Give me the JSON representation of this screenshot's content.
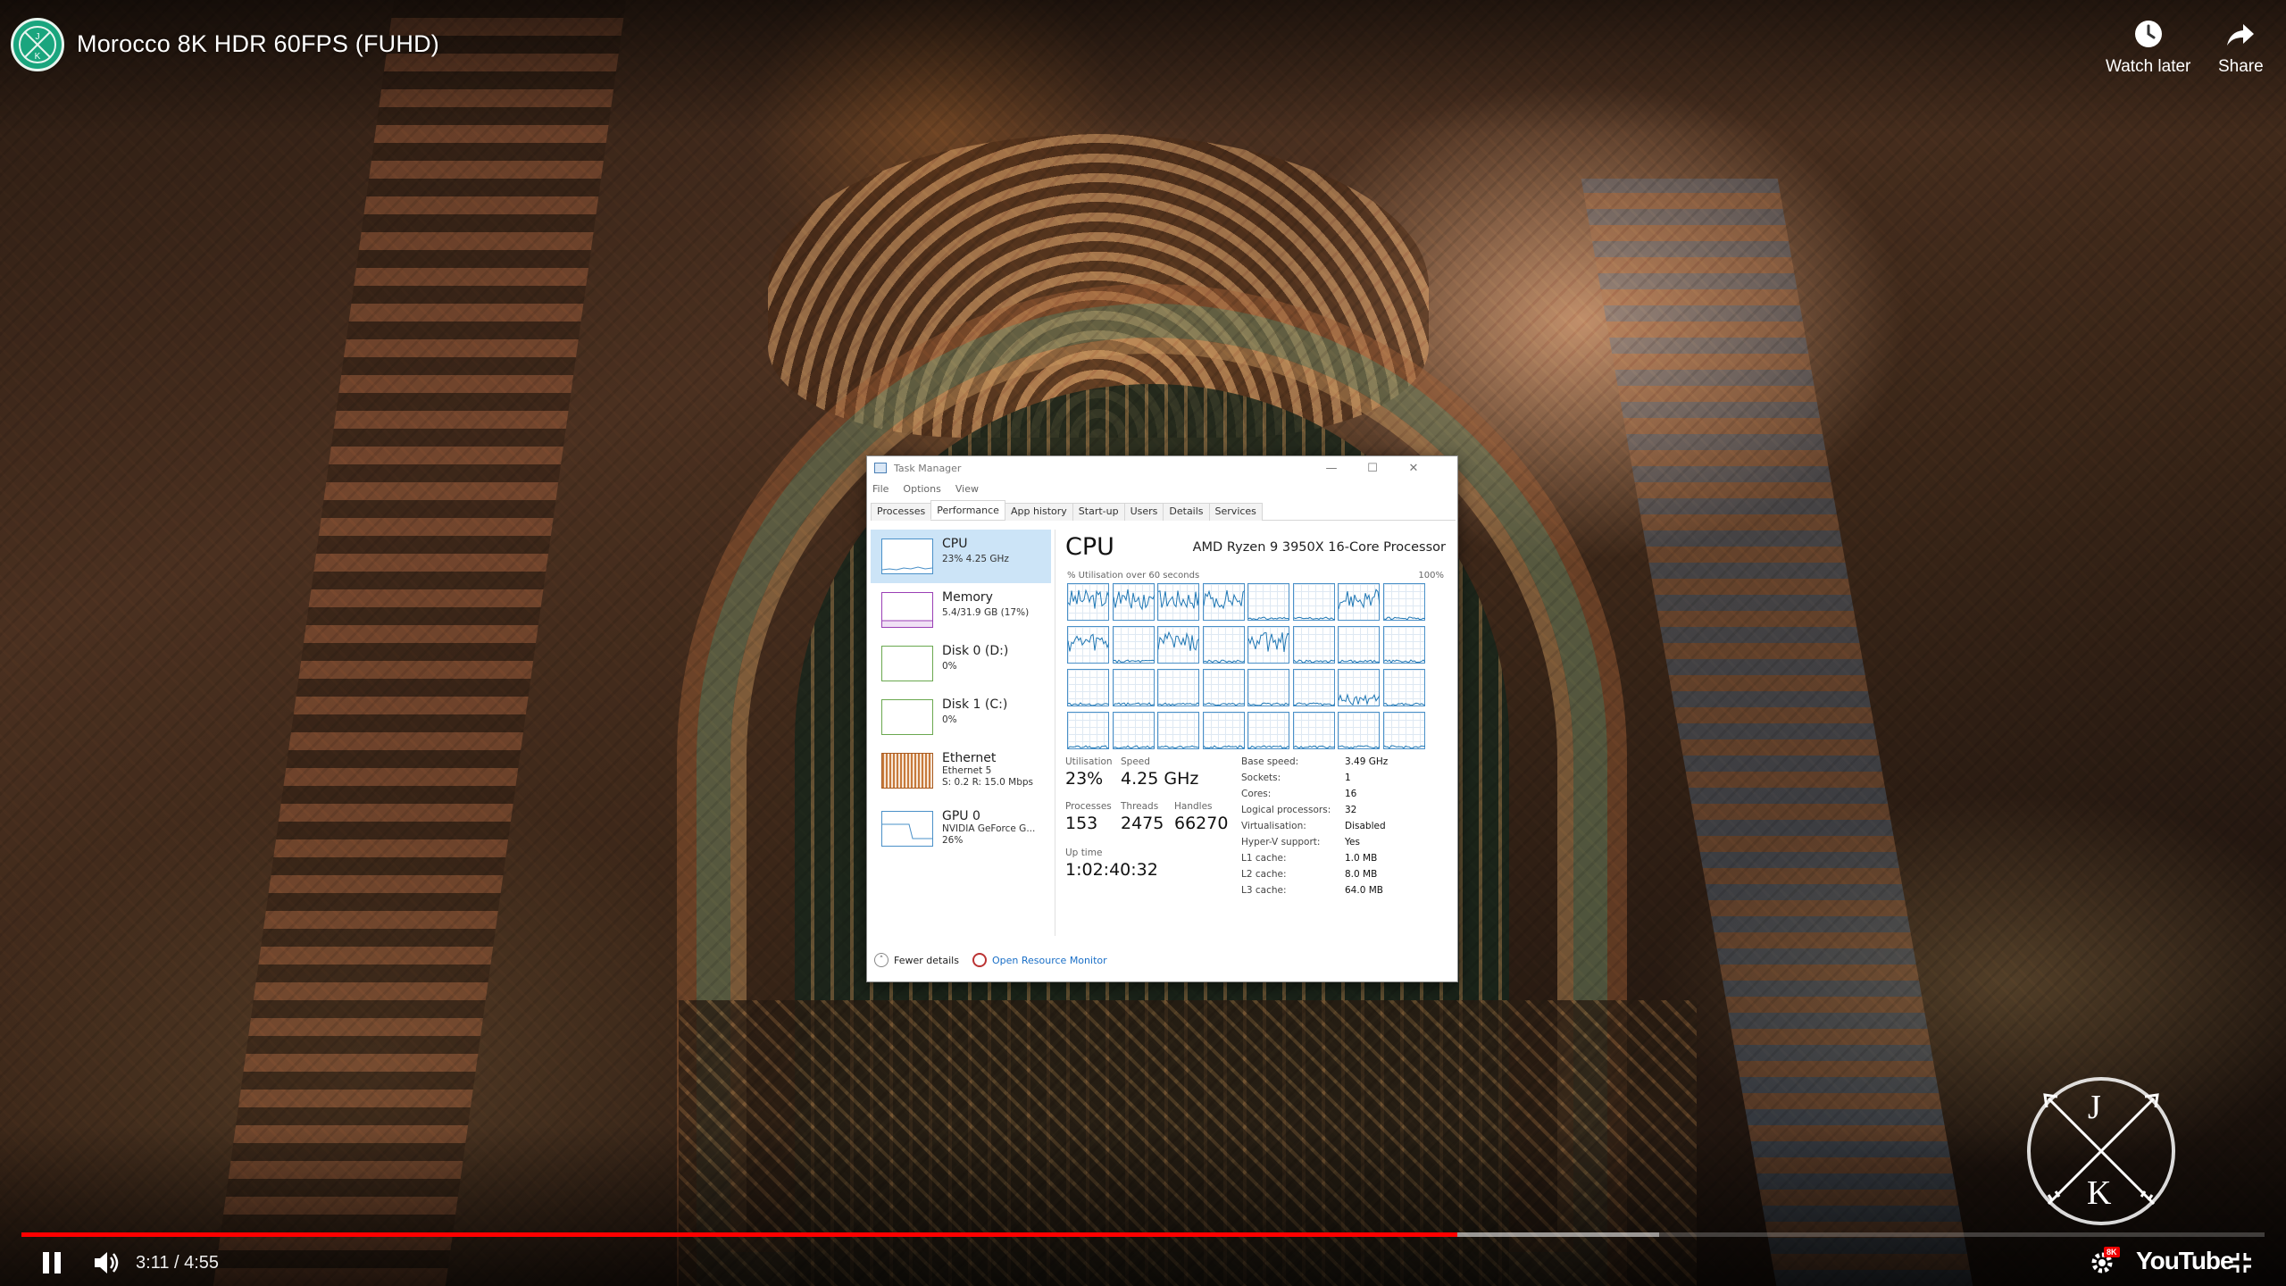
{
  "player": {
    "title": "Morocco 8K HDR 60FPS (FUHD)",
    "watch_later": "Watch later",
    "share": "Share",
    "time": "3:11 / 4:55",
    "progress_played": 0.64,
    "progress_buffered": 0.73,
    "brand": "YouTube",
    "quality_badge": "8K",
    "channel_logo_text": "JK",
    "watermark_top": "J",
    "watermark_bottom": "K",
    "accent_color": "#ff0000"
  },
  "task_manager": {
    "window_title": "Task Manager",
    "menu": [
      "File",
      "Options",
      "View"
    ],
    "tabs": [
      "Processes",
      "Performance",
      "App history",
      "Start-up",
      "Users",
      "Details",
      "Services"
    ],
    "active_tab": "Performance",
    "sidebar": [
      {
        "name": "CPU",
        "sub1": "23% 4.25 GHz",
        "sub2": "",
        "sub3": ""
      },
      {
        "name": "Memory",
        "sub1": "5.4/31.9 GB (17%)",
        "sub2": "",
        "sub3": ""
      },
      {
        "name": "Disk 0 (D:)",
        "sub1": "0%",
        "sub2": "",
        "sub3": ""
      },
      {
        "name": "Disk 1 (C:)",
        "sub1": "0%",
        "sub2": "",
        "sub3": ""
      },
      {
        "name": "Ethernet",
        "sub1": "Ethernet 5",
        "sub2": "S: 0.2  R: 15.0 Mbps",
        "sub3": ""
      },
      {
        "name": "GPU 0",
        "sub1": "NVIDIA GeForce G...",
        "sub2": "26%",
        "sub3": ""
      }
    ],
    "cpu": {
      "heading": "CPU",
      "model": "AMD Ryzen 9 3950X 16-Core Processor",
      "graph_label": "% Utilisation over 60 seconds",
      "graph_max": "100%",
      "utilisation_label": "Utilisation",
      "utilisation": "23%",
      "speed_label": "Speed",
      "speed": "4.25 GHz",
      "processes_label": "Processes",
      "processes": "153",
      "threads_label": "Threads",
      "threads": "2475",
      "handles_label": "Handles",
      "handles": "66270",
      "uptime_label": "Up time",
      "uptime": "1:02:40:32",
      "specs": [
        {
          "k": "Base speed:",
          "v": "3.49 GHz"
        },
        {
          "k": "Sockets:",
          "v": "1"
        },
        {
          "k": "Cores:",
          "v": "16"
        },
        {
          "k": "Logical processors:",
          "v": "32"
        },
        {
          "k": "Virtualisation:",
          "v": "Disabled"
        },
        {
          "k": "Hyper-V support:",
          "v": "Yes"
        },
        {
          "k": "L1 cache:",
          "v": "1.0 MB"
        },
        {
          "k": "L2 cache:",
          "v": "8.0 MB"
        },
        {
          "k": "L3 cache:",
          "v": "64.0 MB"
        }
      ]
    },
    "footer": {
      "fewer_details": "Fewer details",
      "open_resource_monitor": "Open Resource Monitor"
    }
  }
}
